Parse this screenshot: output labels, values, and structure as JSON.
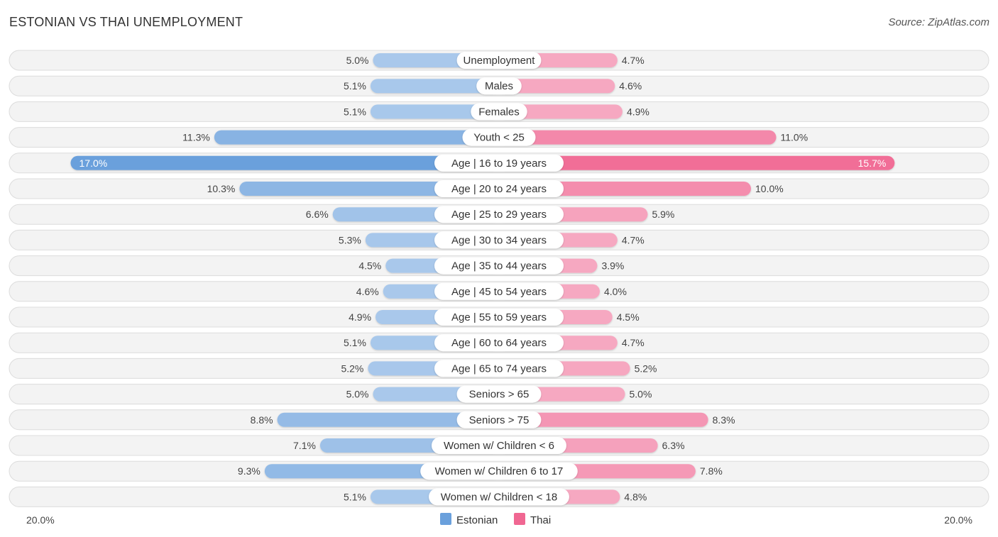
{
  "header": {
    "title": "ESTONIAN VS THAI UNEMPLOYMENT",
    "source": "Source: ZipAtlas.com"
  },
  "chart_data": {
    "type": "bar",
    "orientation": "horizontal-diverging",
    "title": "ESTONIAN VS THAI UNEMPLOYMENT",
    "xlabel": "",
    "ylabel": "",
    "xlim": [
      -20,
      20
    ],
    "axis_labels": {
      "left": "20.0%",
      "right": "20.0%"
    },
    "legend_position": "bottom-center",
    "grid": false,
    "categories": [
      "Unemployment",
      "Males",
      "Females",
      "Youth < 25",
      "Age | 16 to 19 years",
      "Age | 20 to 24 years",
      "Age | 25 to 29 years",
      "Age | 30 to 34 years",
      "Age | 35 to 44 years",
      "Age | 45 to 54 years",
      "Age | 55 to 59 years",
      "Age | 60 to 64 years",
      "Age | 65 to 74 years",
      "Seniors > 65",
      "Seniors > 75",
      "Women w/ Children < 6",
      "Women w/ Children 6 to 17",
      "Women w/ Children < 18"
    ],
    "series": [
      {
        "name": "Estonian",
        "color": "#6aa0dc",
        "light_color": "#a9c8eb",
        "values": [
          5.0,
          5.1,
          5.1,
          11.3,
          17.0,
          10.3,
          6.6,
          5.3,
          4.5,
          4.6,
          4.9,
          5.1,
          5.2,
          5.0,
          8.8,
          7.1,
          9.3,
          5.1
        ],
        "labels": [
          "5.0%",
          "5.1%",
          "5.1%",
          "11.3%",
          "17.0%",
          "10.3%",
          "6.6%",
          "5.3%",
          "4.5%",
          "4.6%",
          "4.9%",
          "5.1%",
          "5.2%",
          "5.0%",
          "8.8%",
          "7.1%",
          "9.3%",
          "5.1%"
        ]
      },
      {
        "name": "Thai",
        "color": "#f06792",
        "light_color": "#f6a8c1",
        "values": [
          4.7,
          4.6,
          4.9,
          11.0,
          15.7,
          10.0,
          5.9,
          4.7,
          3.9,
          4.0,
          4.5,
          4.7,
          5.2,
          5.0,
          8.3,
          6.3,
          7.8,
          4.8
        ],
        "labels": [
          "4.7%",
          "4.6%",
          "4.9%",
          "11.0%",
          "15.7%",
          "10.0%",
          "5.9%",
          "4.7%",
          "3.9%",
          "4.0%",
          "4.5%",
          "4.7%",
          "5.2%",
          "5.0%",
          "8.3%",
          "6.3%",
          "7.8%",
          "4.8%"
        ]
      }
    ]
  }
}
